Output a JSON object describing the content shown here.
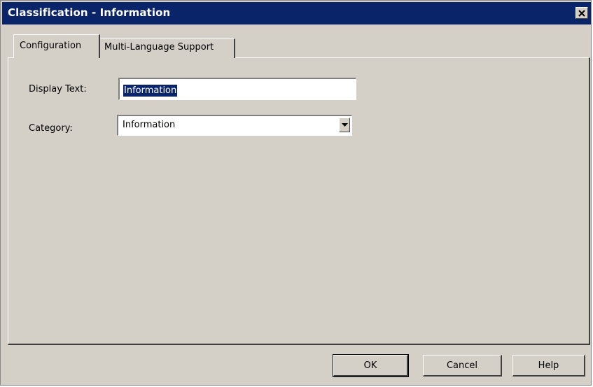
{
  "window": {
    "title": "Classification - Information"
  },
  "tabs": [
    {
      "label": "Configuration",
      "active": true
    },
    {
      "label": "Multi-Language Support",
      "active": false
    }
  ],
  "form": {
    "display_text_label": "Display Text:",
    "display_text_value": "Information",
    "category_label": "Category:",
    "category_value": "Information"
  },
  "buttons": {
    "ok_label": "OK",
    "cancel_label": "Cancel",
    "help_label": "Help"
  },
  "icons": {
    "close": "close-icon",
    "dropdown": "chevron-down-icon"
  },
  "colors": {
    "titlebar": "#0a246a",
    "dialog_face": "#d4d0c8",
    "selection": "#0a246a"
  }
}
